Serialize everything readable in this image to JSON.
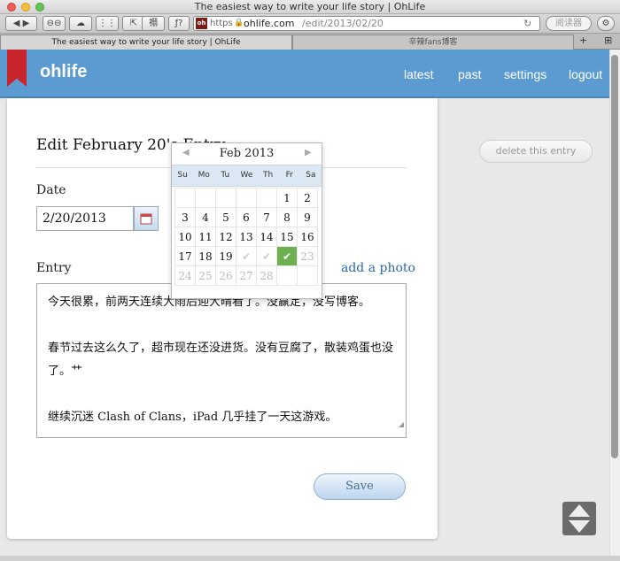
{
  "window": {
    "title": "The easiest way to write your life story | OhLife"
  },
  "toolbar": {
    "url_scheme": "https",
    "url_host": "ohlife.com",
    "url_path": "/edit/2013/02/20",
    "search_placeholder": "阅读器",
    "favicon_text": "oh",
    "btn_hanzi": "禤",
    "btn_f": "ƒ?"
  },
  "tabs": [
    {
      "label": "The easiest way to write your life story | OhLife"
    },
    {
      "label": "辛辣fans博客"
    }
  ],
  "header": {
    "logo": "ohlife",
    "nav": [
      "latest",
      "past",
      "settings",
      "logout"
    ]
  },
  "main": {
    "heading": "Edit February 20's Entry",
    "date_label": "Date",
    "date_value": "2/20/2013",
    "entry_label": "Entry",
    "add_photo": "add a photo",
    "entry_lines": [
      "今天很累，前两天连续大雨后迎大晴看了。没赢定，没写博客。",
      "春节过去这么久了，超市现在还没进货。没有豆腐了，散装鸡蛋也没了。艹",
      "继续沉迷 Clash of Clans，iPad 几乎挂了一天这游戏。"
    ],
    "save": "Save"
  },
  "sidebar": {
    "delete": "delete this entry"
  },
  "calendar": {
    "month_label": "Feb 2013",
    "weekdays": [
      "Su",
      "Mo",
      "Tu",
      "We",
      "Th",
      "Fr",
      "Sa"
    ],
    "selected_day": 20,
    "cells": [
      "",
      "",
      "",
      "",
      "",
      "1",
      "2",
      "3",
      "4",
      "5",
      "6",
      "7",
      "8",
      "9",
      "10",
      "11",
      "12",
      "13",
      "14",
      "15",
      "16",
      "17",
      "18",
      "19",
      "✔",
      "✔",
      "✔",
      "23",
      "24",
      "25",
      "26",
      "27",
      "28",
      "",
      ""
    ]
  },
  "colors": {
    "header": "#5b9bd1",
    "bookmark": "#c8242b",
    "selected": "#6eb04f",
    "link": "#2b69a8"
  }
}
